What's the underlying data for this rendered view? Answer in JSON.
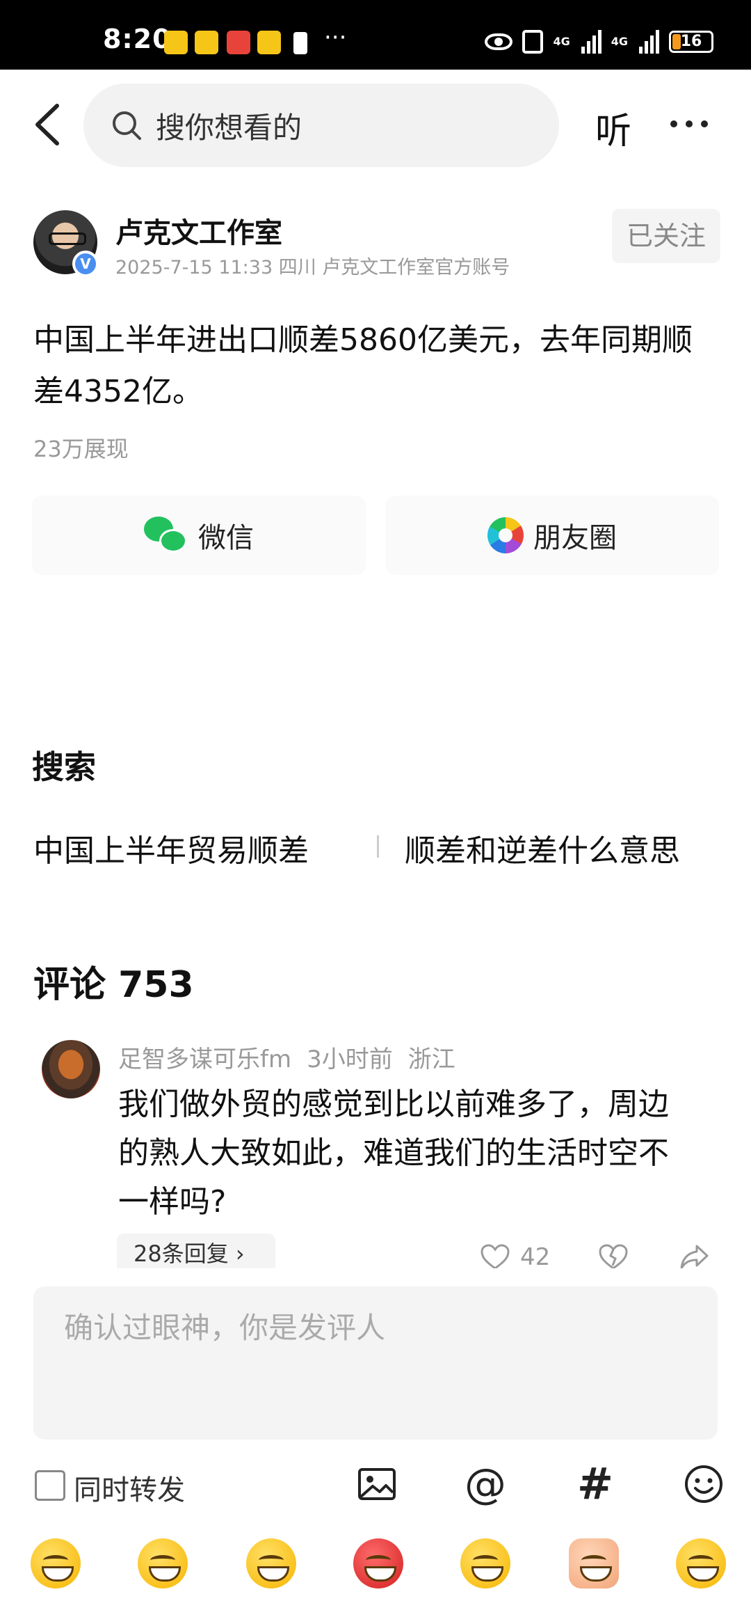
{
  "status_bar": {
    "time": "8:20",
    "battery": "16",
    "network": "4G"
  },
  "header": {
    "search_placeholder": "搜你想看的",
    "listen_label": "听"
  },
  "author": {
    "name": "卢克文工作室",
    "meta": "2025-7-15 11:33 四川 卢克文工作室官方账号",
    "verified_badge": "V",
    "follow_label": "已关注"
  },
  "post": {
    "text": "中国上半年进出口顺差5860亿美元，去年同期顺差4352亿。",
    "views": "23万展现"
  },
  "share": {
    "wechat_label": "微信",
    "moments_label": "朋友圈"
  },
  "search_section": {
    "title": "搜索",
    "suggestions": [
      "中国上半年贸易顺差",
      "顺差和逆差什么意思"
    ]
  },
  "comments": {
    "title": "评论 753",
    "items": [
      {
        "user": "足智多谋可乐fm",
        "time": "3小时前",
        "location": "浙江",
        "text": "我们做外贸的感觉到比以前难多了，周边的熟人大致如此，难道我们的生活时空不一样吗?",
        "replies": "28条回复 ›",
        "likes": "42"
      }
    ]
  },
  "composer": {
    "placeholder": "确认过眼神，你是发评人",
    "repost_label": "同时转发",
    "at_symbol": "@",
    "hash_symbol": "#"
  },
  "icons": [
    "back-arrow-icon",
    "search-icon",
    "more-icon",
    "wechat-icon",
    "moments-icon",
    "like-icon",
    "dislike-icon",
    "share-icon",
    "image-icon",
    "at-icon",
    "hash-icon",
    "emoji-icon"
  ],
  "colors": {
    "accent_green": "#22c15e",
    "verified_blue": "#4a8ff0",
    "muted_text": "#999999"
  }
}
